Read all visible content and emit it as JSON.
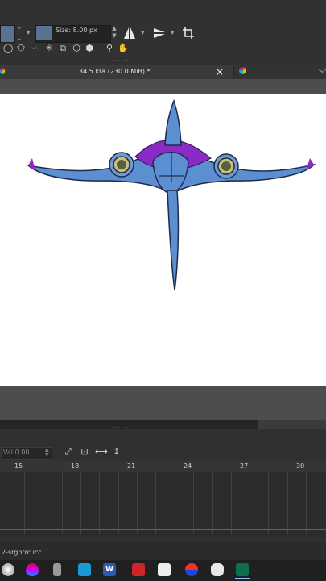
{
  "toolbar": {
    "size_label": "Size: 8.00 px",
    "brush_color": "#5a7391"
  },
  "tabs": {
    "active_title": "34.5.kra (230.0 MiB) *",
    "close_glyph": "×",
    "second_title": "Sc"
  },
  "animation": {
    "value_placeholder": "Val:0.00",
    "ruler_ticks": [
      "15",
      "18",
      "21",
      "24",
      "27",
      "30"
    ]
  },
  "status": {
    "profile_text": "2-srgbtrc.icc"
  },
  "taskbar": {
    "apps": [
      "krita-icon",
      "paint-drop-icon",
      "usb-icon",
      "grid-app-icon",
      "word-icon",
      "amd-icon",
      "whiteboard-icon",
      "ball-icon",
      "discord-icon",
      "active-app-icon"
    ],
    "word_letter": "W"
  },
  "colors": {
    "accent": "#5a7391",
    "creature_body": "#5b8fd1",
    "creature_wing": "#8b2bc7",
    "timeline_curve": "#3f6d8a"
  }
}
